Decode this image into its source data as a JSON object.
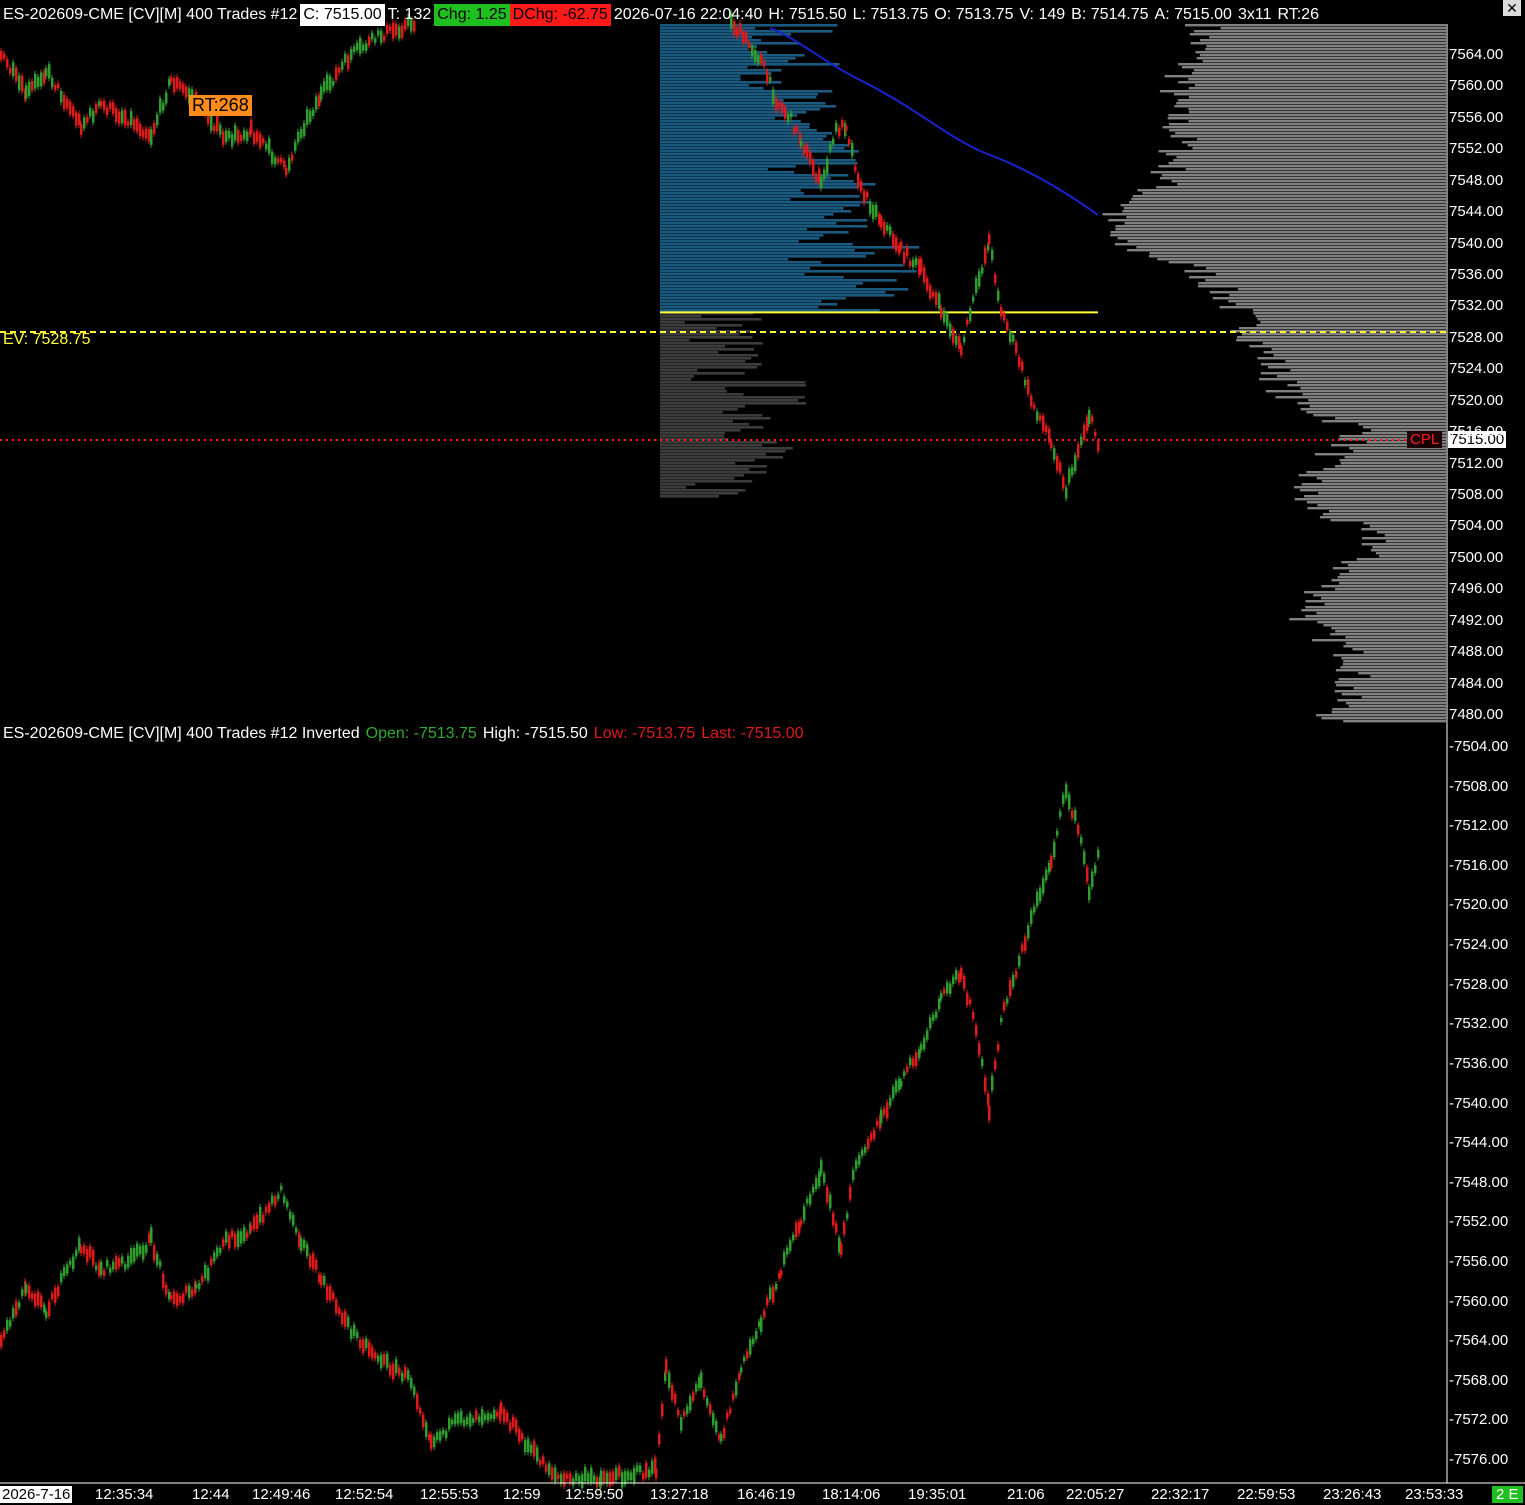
{
  "header": {
    "symbol": "ES-202609-CME [CV][M]  400 Trades #12",
    "close": "C: 7515.00",
    "trades": "T: 132",
    "chg": "Chg: 1.25",
    "dchg": "DChg: -62.75",
    "datetime": "2026-07-16 22:04:40",
    "high": "H: 7515.50",
    "low": "L: 7513.75",
    "open": "O: 7513.75",
    "volume": "V: 149",
    "bid": "B: 7514.75",
    "ask": "A: 7515.00",
    "size": "3x11",
    "rt": "RT:26"
  },
  "top_chart": {
    "rt_badge": "RT:268",
    "ev_label": "EV: 7528.75",
    "cpl_label": "CPL",
    "last_price": "7515.00",
    "ev_price": 7528.75,
    "last_value": 7515.0,
    "poc_price": 7531.25,
    "axis_labels": [
      "7564.00",
      "7560.00",
      "7556.00",
      "7552.00",
      "7548.00",
      "7544.00",
      "7540.00",
      "7536.00",
      "7532.00",
      "7528.00",
      "7524.00",
      "7520.00",
      "7516.00",
      "7512.00",
      "7508.00",
      "7504.00",
      "7500.00",
      "7496.00",
      "7492.00",
      "7488.00",
      "7484.00",
      "7480.00"
    ]
  },
  "bottom_chart": {
    "symbol": "ES-202609-CME [CV][M]  400 Trades #12 Inverted",
    "open": "Open: -7513.75",
    "high": "High: -7515.50",
    "low": "Low: -7513.75",
    "last": "Last: -7515.00",
    "axis_labels": [
      "-7504.00",
      "-7508.00",
      "-7512.00",
      "-7516.00",
      "-7520.00",
      "-7524.00",
      "-7528.00",
      "-7532.00",
      "-7536.00",
      "-7540.00",
      "-7544.00",
      "-7548.00",
      "-7552.00",
      "-7556.00",
      "-7560.00",
      "-7564.00",
      "-7568.00",
      "-7572.00",
      "-7576.00"
    ]
  },
  "time_axis": {
    "date": "2026-7-16",
    "labels": [
      "12:35:34",
      "12:44",
      "12:49:46",
      "12:52:54",
      "12:55:53",
      "12:59",
      "12:59:50",
      "13:27:18",
      "16:46:19",
      "18:14:06",
      "19:35:01",
      "21:06",
      "22:05:27",
      "22:32:17",
      "22:59:53",
      "23:26:43",
      "23:53:33"
    ],
    "status": "2 E"
  },
  "colors": {
    "background": "#000000",
    "up_bar": "#2e9e2e",
    "down_bar": "#e01a1a",
    "ev_line": "#ffff33",
    "cpl_line": "#ff2020",
    "session_profile_blue": "#1a5a80",
    "session_profile_gray": "#3c3c3c",
    "volume_profile": "#808080",
    "vwap_line": "#1a22cc",
    "chg_bg": "#1fbf1f",
    "dchg_bg": "#ff1a1a",
    "rt_badge_bg": "#ff8c1a"
  },
  "icons": {
    "close": "close-icon"
  }
}
